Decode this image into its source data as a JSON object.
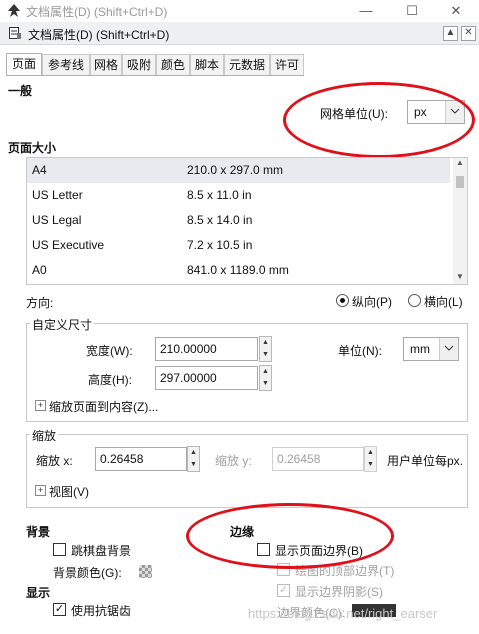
{
  "window": {
    "title": "文档属性(D) (Shift+Ctrl+D)",
    "minimize_icon": "minimize-icon",
    "maximize_icon": "maximize-icon",
    "close_icon": "close-icon"
  },
  "dock": {
    "title": "文档属性(D) (Shift+Ctrl+D)"
  },
  "tabs": [
    "页面",
    "参考线",
    "网格",
    "吸附",
    "颜色",
    "脚本",
    "元数据",
    "许可"
  ],
  "general": {
    "heading": "一般",
    "grid_units_label": "网格单位(U):",
    "grid_units_value": "px"
  },
  "page_size": {
    "heading": "页面大小",
    "rows": [
      {
        "name": "A4",
        "size": "210.0 x 297.0 mm"
      },
      {
        "name": "US Letter",
        "size": "8.5 x 11.0 in"
      },
      {
        "name": "US Legal",
        "size": "8.5 x 14.0 in"
      },
      {
        "name": "US Executive",
        "size": "7.2 x 10.5 in"
      },
      {
        "name": "A0",
        "size": "841.0 x 1189.0 mm"
      }
    ]
  },
  "orientation": {
    "label": "方向:",
    "portrait": "纵向(P)",
    "landscape": "横向(L)"
  },
  "custom_size": {
    "title": "自定义尺寸",
    "width_label": "宽度(W):",
    "width_value": "210.00000",
    "height_label": "高度(H):",
    "height_value": "297.00000",
    "units_label": "单位(N):",
    "units_value": "mm",
    "resize_label": "缩放页面到内容(Z)..."
  },
  "scale": {
    "title": "缩放",
    "scale_x_label": "缩放 x:",
    "scale_x_value": "0.26458",
    "scale_y_label": "缩放 y:",
    "scale_y_value": "0.26458",
    "user_units_label": "用户单位每px.",
    "viewbox_label": "视图(V)"
  },
  "background": {
    "heading": "背景",
    "checkerboard_label": "跳棋盘背景",
    "color_label": "背景颜色(G):"
  },
  "display": {
    "heading": "显示",
    "antialias_label": "使用抗锯齿"
  },
  "border": {
    "heading": "边缘",
    "show_border_label": "显示页面边界(B)",
    "border_on_top_label": "绘图的顶部边界(T)",
    "border_shadow_label": "显示边界阴影(S)",
    "border_color_label": "边界颜色(C):"
  },
  "watermark": "https://blog.csdn.net/right_earser",
  "colors": {
    "annotation": "#e0101a",
    "accent": "#0078d7"
  }
}
